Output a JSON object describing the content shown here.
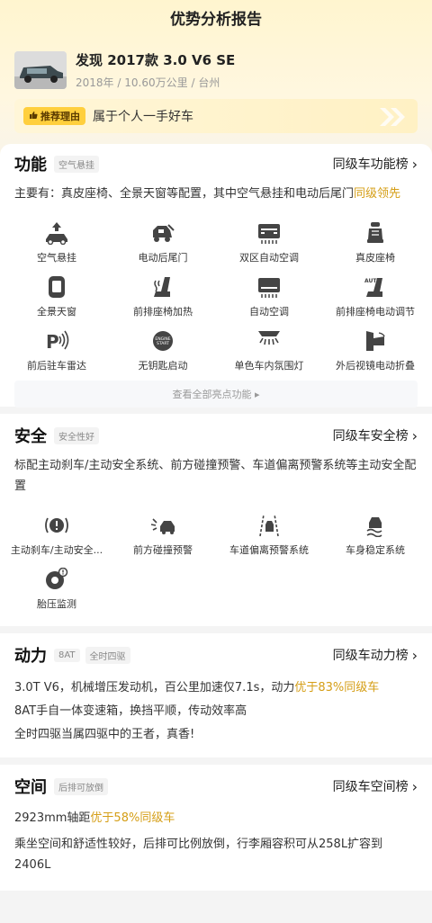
{
  "header": {
    "title": "优势分析报告"
  },
  "car": {
    "title": "发现 2017款 3.0 V6 SE",
    "year": "2018年",
    "mileage": "10.60万公里",
    "city": "台州",
    "sep": "/"
  },
  "reason": {
    "badge": "推荐理由",
    "text": "属于个人一手好车"
  },
  "function": {
    "title": "功能",
    "tag": "空气悬挂",
    "rank": "同级车功能榜",
    "desc_prefix": "主要有：真皮座椅、全景天窗等配置，其中空气悬挂和电动后尾门",
    "desc_highlight": "同级领先",
    "items": [
      {
        "label": "空气悬挂",
        "icon": "air-suspension-icon"
      },
      {
        "label": "电动后尾门",
        "icon": "power-tailgate-icon"
      },
      {
        "label": "双区自动空调",
        "icon": "dual-zone-ac-icon"
      },
      {
        "label": "真皮座椅",
        "icon": "leather-seat-icon"
      },
      {
        "label": "全景天窗",
        "icon": "panoramic-sunroof-icon"
      },
      {
        "label": "前排座椅加热",
        "icon": "seat-heating-icon"
      },
      {
        "label": "自动空调",
        "icon": "auto-ac-icon"
      },
      {
        "label": "前排座椅电动调节",
        "icon": "power-seat-icon"
      },
      {
        "label": "前后驻车雷达",
        "icon": "parking-radar-icon"
      },
      {
        "label": "无钥匙启动",
        "icon": "keyless-start-icon"
      },
      {
        "label": "单色车内氛围灯",
        "icon": "ambient-light-icon"
      },
      {
        "label": "外后视镜电动折叠",
        "icon": "mirror-fold-icon"
      }
    ],
    "more": "查看全部亮点功能 ▸"
  },
  "safety": {
    "title": "安全",
    "tag": "安全性好",
    "rank": "同级车安全榜",
    "desc": "标配主动刹车/主动安全系统、前方碰撞预警、车道偏离预警系统等主动安全配置",
    "items": [
      {
        "label": "主动刹车/主动安全...",
        "icon": "active-brake-icon"
      },
      {
        "label": "前方碰撞预警",
        "icon": "collision-warning-icon"
      },
      {
        "label": "车道偏离预警系统",
        "icon": "lane-departure-icon"
      },
      {
        "label": "车身稳定系统",
        "icon": "stability-control-icon"
      },
      {
        "label": "胎压监测",
        "icon": "tire-pressure-icon"
      }
    ]
  },
  "power": {
    "title": "动力",
    "tags": [
      "8AT",
      "全时四驱"
    ],
    "rank": "同级车动力榜",
    "line1_prefix": "3.0T V6，机械增压发动机，百公里加速仅7.1s，动力",
    "line1_highlight": "优于83%同级车",
    "line2": "8AT手自一体变速箱，换挡平顺，传动效率高",
    "line3": "全时四驱当属四驱中的王者，真香!"
  },
  "space": {
    "title": "空间",
    "tag": "后排可放倒",
    "rank": "同级车空间榜",
    "line1_prefix": "2923mm轴距",
    "line1_highlight": "优于58%同级车",
    "line2": "乘坐空间和舒适性较好，后排可比例放倒，行李厢容积可从258L扩容到2406L"
  },
  "colors": {
    "accent": "#d59e16",
    "badge": "#ffcf3d",
    "icon": "#444444"
  }
}
